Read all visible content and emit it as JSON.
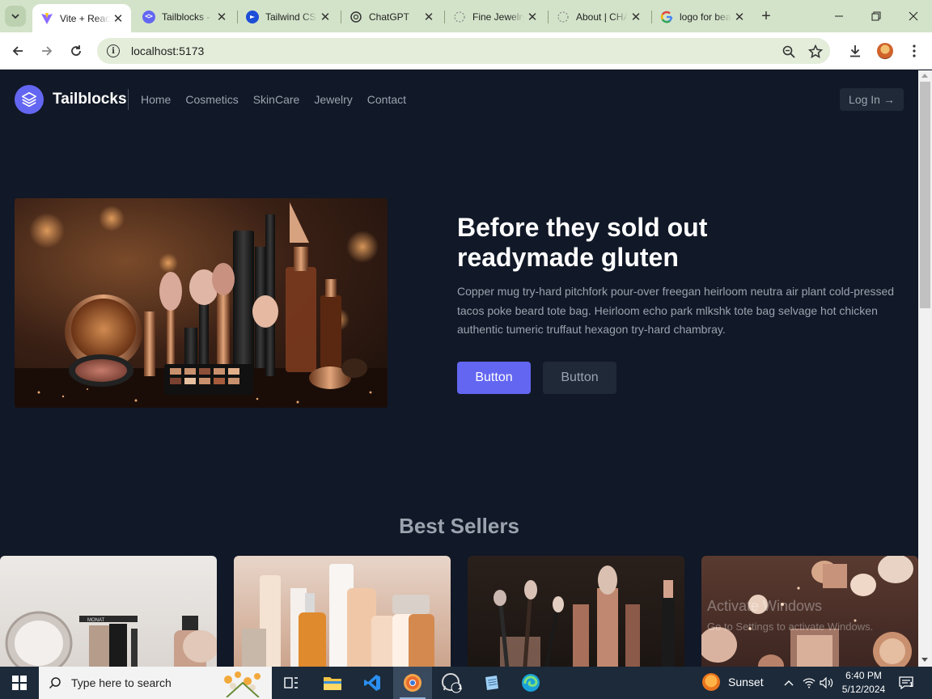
{
  "browser": {
    "tabs": [
      {
        "title": "Vite + React",
        "active": true
      },
      {
        "title": "Tailblocks - Ready-made",
        "active": false
      },
      {
        "title": "Tailwind CSS",
        "active": false
      },
      {
        "title": "ChatGPT",
        "active": false
      },
      {
        "title": "Fine Jewelry",
        "active": false
      },
      {
        "title": "About | CHANEL",
        "active": false
      },
      {
        "title": "logo for beauty",
        "active": false
      }
    ],
    "url": "localhost:5173",
    "new_tab": "+"
  },
  "site": {
    "brand": "Tailblocks",
    "nav": [
      "Home",
      "Cosmetics",
      "SkinCare",
      "Jewelry",
      "Contact"
    ],
    "login": "Log In",
    "login_arrow": "→"
  },
  "hero": {
    "title": "Before they sold out readymade gluten",
    "text": "Copper mug try-hard pitchfork pour-over freegan heirloom neutra air plant cold-pressed tacos poke beard tote bag. Heirloom echo park mlkshk tote bag selvage hot chicken authentic tumeric truffaut hexagon try-hard chambray.",
    "primary_button": "Button",
    "secondary_button": "Button"
  },
  "best_sellers": {
    "title": "Best Sellers",
    "product_label": "MONAT",
    "watermark_title": "Activate Windows",
    "watermark_sub": "Go to Settings to activate Windows."
  },
  "taskbar": {
    "search_placeholder": "Type here to search",
    "weather": "Sunset",
    "time": "6:40 PM",
    "date": "5/12/2024",
    "whatsapp_badge": "1",
    "notification_badge": "1"
  },
  "colors": {
    "page_bg": "#111827",
    "accent": "#6366f1",
    "muted_text": "#9ca3af",
    "chrome_tabstrip": "#d3e3c9"
  }
}
